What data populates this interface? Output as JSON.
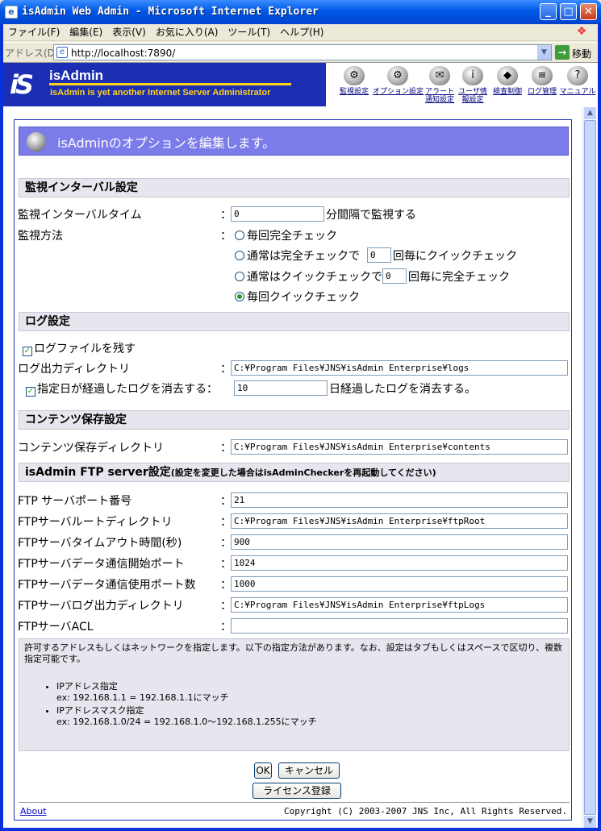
{
  "window": {
    "title": "isAdmin Web Admin - Microsoft Internet Explorer",
    "icon": "ie-icon",
    "minimize": "_",
    "maximize": "□",
    "close": "✕"
  },
  "menu": [
    "ファイル(F)",
    "編集(E)",
    "表示(V)",
    "お気に入り(A)",
    "ツール(T)",
    "ヘルプ(H)"
  ],
  "address": {
    "label": "アドレス(D)",
    "url": "http://localhost:7890/",
    "go": "移動"
  },
  "banner": {
    "title": "isAdmin",
    "subtitle": "isAdmin is yet another Internet Server Administrator",
    "logo_mark": "iS"
  },
  "toolbar": [
    {
      "label": "監視設定",
      "icon": "monitor-settings-icon"
    },
    {
      "label": "オプション設定",
      "icon": "option-settings-icon"
    },
    {
      "label": "アラート通知設定",
      "icon": "alert-settings-icon"
    },
    {
      "label": "ユーザ情報設定",
      "icon": "user-settings-icon"
    },
    {
      "label": "検査制御",
      "icon": "inspection-control-icon"
    },
    {
      "label": "ログ管理",
      "icon": "log-management-icon"
    },
    {
      "label": "マニュアル",
      "icon": "manual-icon"
    }
  ],
  "header": "isAdminのオプションを編集します。",
  "sections": {
    "monitor": "監視インターバル設定",
    "log": "ログ設定",
    "contents": "コンテンツ保存設定",
    "ftp": "isAdmin FTP server設定",
    "ftp_note": "(設定を変更した場合はisAdminCheckerを再起動してください)"
  },
  "monitor": {
    "interval_label": "監視インターバルタイム",
    "colon": "：",
    "interval_value": "0",
    "interval_suffix": "分間隔で監視する",
    "method_label": "監視方法",
    "opt1": "毎回完全チェック",
    "opt2_pre": "通常は完全チェックで",
    "opt2_value": "0",
    "opt2_post": "回毎にクイックチェック",
    "opt3_pre": "通常はクイックチェックで",
    "opt3_value": "0",
    "opt3_post": "回毎に完全チェック",
    "opt4": "毎回クイックチェック",
    "selected": "毎回クイックチェック"
  },
  "log": {
    "keep_label": "ログファイルを残す",
    "keep_checked": true,
    "dir_label": "ログ出力ディレクトリ",
    "dir_value": "C:¥Program Files¥JNS¥isAdmin Enterprise¥logs",
    "expire_label": "指定日が経過したログを消去する：",
    "expire_checked": true,
    "expire_value": "10",
    "expire_suffix": "日経過したログを消去する。"
  },
  "contents": {
    "dir_label": "コンテンツ保存ディレクトリ",
    "dir_value": "C:¥Program Files¥JNS¥isAdmin Enterprise¥contents"
  },
  "ftp": {
    "port_label": "FTP サーバポート番号",
    "port_value": "21",
    "root_label": "FTPサーバルートディレクトリ",
    "root_value": "C:¥Program Files¥JNS¥isAdmin Enterprise¥ftpRoot",
    "timeout_label": "FTPサーバタイムアウト時間(秒)",
    "timeout_value": "900",
    "dport_label": "FTPサーバデータ通信開始ポート",
    "dport_value": "1024",
    "dcount_label": "FTPサーバデータ通信使用ポート数",
    "dcount_value": "1000",
    "logdir_label": "FTPサーバログ出力ディレクトリ",
    "logdir_value": "C:¥Program Files¥JNS¥isAdmin Enterprise¥ftpLogs",
    "acl_label": "FTPサーバACL",
    "acl_value": ""
  },
  "note": {
    "intro": "許可するアドレスもしくはネットワークを指定します。以下の指定方法があります。なお、設定はタブもしくはスペースで区切り、複数指定可能です。",
    "item1_title": "IPアドレス指定",
    "item1_ex": "ex: 192.168.1.1 = 192.168.1.1にマッチ",
    "item2_title": "IPアドレスマスク指定",
    "item2_ex": "ex: 192.168.1.0/24 = 192.168.1.0〜192.168.1.255にマッチ"
  },
  "buttons": {
    "ok": "OK",
    "cancel": "キャンセル",
    "license": "ライセンス登録"
  },
  "footer": {
    "about": "About",
    "copyright": "Copyright (C) 2003-2007 JNS Inc, All Rights Reserved."
  },
  "colors": {
    "banner": "#1c2fb4",
    "accent_yellow": "#ffd21c",
    "header_bar": "#7b7bea"
  }
}
